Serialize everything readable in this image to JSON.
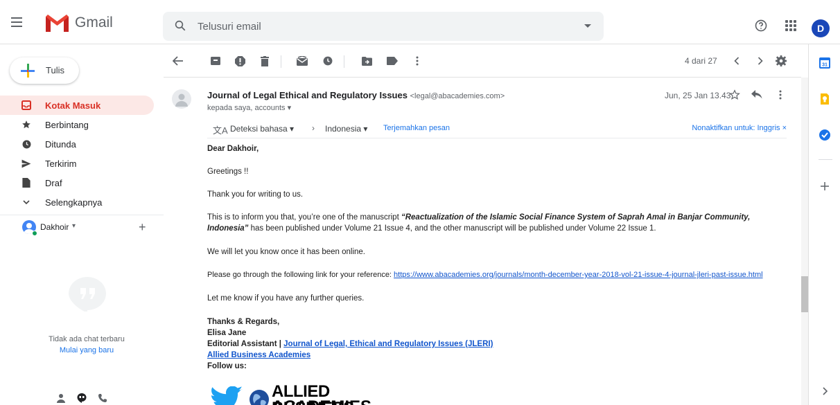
{
  "app": {
    "name": "Gmail"
  },
  "search": {
    "placeholder": "Telusuri email"
  },
  "account": {
    "initial": "D"
  },
  "compose": {
    "label": "Tulis"
  },
  "nav": [
    {
      "label": "Kotak Masuk",
      "icon": "inbox-icon",
      "active": true
    },
    {
      "label": "Berbintang",
      "icon": "star-icon"
    },
    {
      "label": "Ditunda",
      "icon": "clock-icon"
    },
    {
      "label": "Terkirim",
      "icon": "send-icon"
    },
    {
      "label": "Draf",
      "icon": "draft-icon"
    },
    {
      "label": "Selengkapnya",
      "icon": "chevron-down-icon"
    }
  ],
  "chat": {
    "user": "Dakhoir",
    "empty_text": "Tidak ada chat terbaru",
    "start_new": "Mulai yang baru"
  },
  "toolbar": {
    "pager": "4 dari 27"
  },
  "message": {
    "sender_name": "Journal of Legal Ethical and Regulatory Issues",
    "sender_email": "<legal@abacademies.com>",
    "to": "kepada saya, accounts",
    "date": "Jun, 25 Jan 13.43",
    "translate": {
      "detect": "Deteksi bahasa",
      "target": "Indonesia",
      "translate_link": "Terjemahkan pesan",
      "disable": "Nonaktifkan untuk: Inggris"
    },
    "body": {
      "greeting": "Dear Dakhoir,",
      "line1": "Greetings !!",
      "line2": "Thank you for writing to us.",
      "line3_pre": "This is to inform you that, you’re one of the manuscript ",
      "line3_title_a": "“Reactualization of the Islamic Social Finance System of Saprah Amal in Banjar Community,",
      "line3_title_b": "Indonesia”",
      "line3_post": " has been published under Volume 21 Issue 4, and the other manuscript will be published under Volume 22 Issue 1.",
      "line4": "We will let you know once it has been online.",
      "line5_pre": "Please go through the following link for your reference: ",
      "line5_link": "https://www.abacademies.org/journals/month-december-year-2018-vol-21-issue-4-journal-jleri-past-issue.html",
      "line6": "Let me know if you have any further queries.",
      "sign1": "Thanks & Regards,",
      "sign2": "Elisa Jane",
      "sign3_pre": "Editorial Assistant | ",
      "sign3_link": "Journal of Legal, Ethical and Regulatory Issues (JLERI)",
      "sign4_link": "Allied Business Academies",
      "sign5": "Follow us:",
      "logo_text_1": "ALLIED BUSINESS",
      "logo_text_2": "ACADEMIES"
    }
  },
  "colors": {
    "brand_red": "#d93025",
    "active_bg": "#fce8e6",
    "link": "#1155cc",
    "accent_blue": "#1a73e8",
    "avatar_blue": "#1a47b8"
  }
}
